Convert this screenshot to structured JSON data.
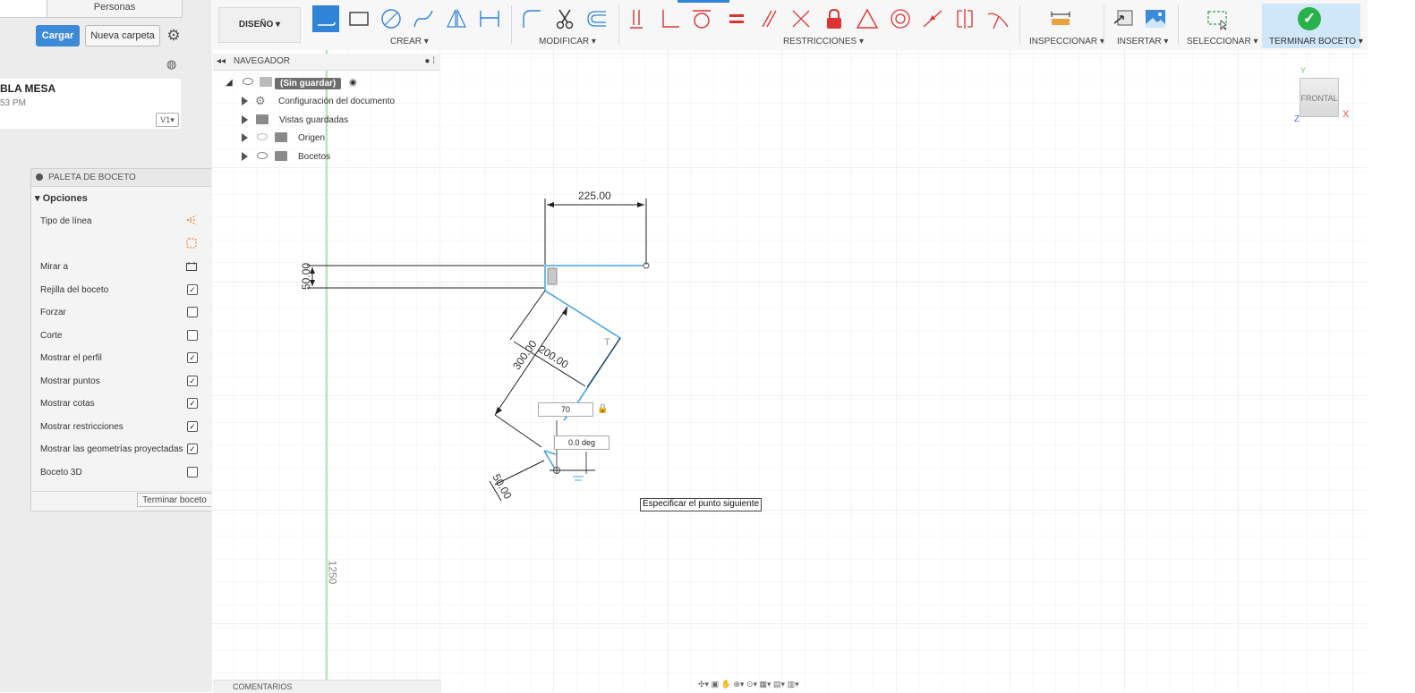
{
  "data_panel": {
    "tab_people": "Personas",
    "upload_label": "Cargar",
    "new_folder_label": "Nueva carpeta",
    "file_title": "BLA MESA",
    "file_time": "53 PM",
    "version": "V1"
  },
  "toolbar": {
    "workspace": "DISEÑO",
    "groups": {
      "create": "CREAR",
      "modify": "MODIFICAR",
      "constraints": "RESTRICCIONES",
      "inspect": "INSPECCIONAR",
      "insert": "INSERTAR",
      "select": "SELECCIONAR",
      "finish": "TERMINAR BOCETO"
    },
    "accent_color": "#2f84d8",
    "finish_color": "#28b24b"
  },
  "navigator": {
    "title": "NAVEGADOR",
    "root": "(Sin guardar)",
    "items": [
      {
        "label": "Configuración del documento",
        "icon": "gear-icon"
      },
      {
        "label": "Vistas guardadas",
        "icon": "folder-icon"
      },
      {
        "label": "Origen",
        "icon": "folder-icon"
      },
      {
        "label": "Bocetos",
        "icon": "folder-icon"
      }
    ]
  },
  "palette": {
    "title": "PALETA DE BOCETO",
    "section": "Opciones",
    "options": [
      {
        "label": "Tipo de línea",
        "control": "linetype-icon"
      },
      {
        "label": "",
        "control": "linetype-construction-icon"
      },
      {
        "label": "Mirar a",
        "control": "look-at-icon"
      },
      {
        "label": "Rejilla del boceto",
        "checked": true
      },
      {
        "label": "Forzar",
        "checked": false
      },
      {
        "label": "Corte",
        "checked": false
      },
      {
        "label": "Mostrar el perfil",
        "checked": true
      },
      {
        "label": "Mostrar puntos",
        "checked": true
      },
      {
        "label": "Mostrar cotas",
        "checked": true
      },
      {
        "label": "Mostrar restricciones",
        "checked": true
      },
      {
        "label": "Mostrar las geometrías proyectadas",
        "checked": true
      },
      {
        "label": "Boceto 3D",
        "checked": false
      }
    ],
    "finish_button": "Terminar boceto"
  },
  "sketch": {
    "dim_top": "225.00",
    "dim_left": "50.00",
    "dim_diag_a": "300.00",
    "dim_diag_b": "200.00",
    "dim_bottom": "50.00",
    "dim_vertical": "1250",
    "length_input": "70",
    "angle_input": "0.0 deg",
    "tooltip": "Especificar el punto siguiente"
  },
  "viewcube": {
    "face": "FRONTAL",
    "axis_x": "X",
    "axis_y": "Y",
    "axis_z": "Z"
  },
  "comments": {
    "title": "COMENTARIOS"
  }
}
